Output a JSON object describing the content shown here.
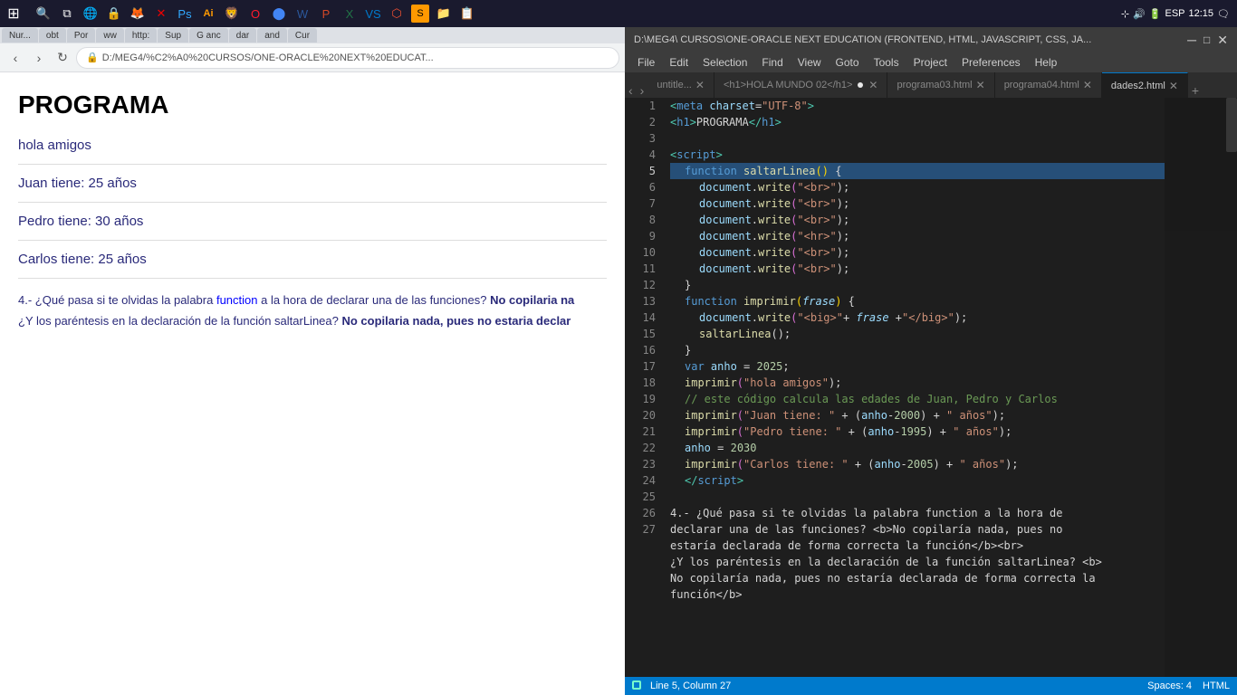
{
  "taskbar": {
    "time": "12:15",
    "lang": "ESP"
  },
  "browser": {
    "tabs": [
      {
        "label": "Nur...",
        "active": false
      },
      {
        "label": "obt",
        "active": false
      },
      {
        "label": "Por",
        "active": false
      },
      {
        "label": "ww",
        "active": false
      },
      {
        "label": "http:",
        "active": false
      },
      {
        "label": "Sup",
        "active": false
      },
      {
        "label": "G anc",
        "active": false
      },
      {
        "label": "dar",
        "active": false
      },
      {
        "label": "and",
        "active": false
      },
      {
        "label": "Cur",
        "active": false
      }
    ],
    "address": "D:/MEG4/%C2%A0%20CURSOS/ONE-ORACLE%20NEXT%20EDUCAT...",
    "content": {
      "title": "PROGRAMA",
      "line1": "hola amigos",
      "line2": "Juan tiene: 25 años",
      "line3": "Pedro tiene: 30 años",
      "line4": "Carlos tiene: 25 años",
      "question1_pre": "4.- ¿Qué pasa si te olvidas la palabra ",
      "question1_keyword": "function",
      "question1_mid": " a la hora de declarar una de las funciones? ",
      "question1_bold": "No copilaria na",
      "question2_pre": "¿Y los paréntesis en la declaración de la función saltarLinea? ",
      "question2_bold": "No copilaria nada, pues no estaria declar"
    }
  },
  "vscode": {
    "titlebar": "D:\\MEG4\\ CURSOS\\ONE-ORACLE NEXT EDUCATION (FRONTEND, HTML, JAVASCRIPT, CSS, JA...",
    "tabs": [
      {
        "label": "untitle...",
        "active": false
      },
      {
        "label": "<h1>HOLA MUNDO 02</h1>",
        "active": false,
        "dot": true
      },
      {
        "label": "programa03.html",
        "active": false
      },
      {
        "label": "programa04.html",
        "active": false
      },
      {
        "label": "dades2.html",
        "active": true
      }
    ],
    "menu": [
      "File",
      "Edit",
      "Selection",
      "Find",
      "View",
      "Goto",
      "Tools",
      "Project",
      "Preferences",
      "Help"
    ],
    "lines": [
      {
        "num": 1,
        "tokens": [
          {
            "t": "<",
            "c": "tag"
          },
          {
            "t": "meta",
            "c": "kw"
          },
          {
            "t": " charset",
            "c": "attr"
          },
          {
            "t": "=",
            "c": "op"
          },
          {
            "t": "\"UTF-8\"",
            "c": "str"
          },
          {
            "t": ">",
            "c": "tag"
          }
        ]
      },
      {
        "num": 2,
        "tokens": [
          {
            "t": "<",
            "c": "tag"
          },
          {
            "t": "h1",
            "c": "kw"
          },
          {
            "t": ">",
            "c": "tag"
          },
          {
            "t": "PROGRAMA",
            "c": "text-white"
          },
          {
            "t": "</",
            "c": "tag"
          },
          {
            "t": "h1",
            "c": "kw"
          },
          {
            "t": ">",
            "c": "tag"
          }
        ]
      },
      {
        "num": 3,
        "tokens": []
      },
      {
        "num": 4,
        "tokens": [
          {
            "t": "<",
            "c": "tag"
          },
          {
            "t": "script",
            "c": "kw"
          },
          {
            "t": ">",
            "c": "tag"
          }
        ]
      },
      {
        "num": 5,
        "tokens": [
          {
            "t": "    function ",
            "c": "kw"
          },
          {
            "t": "saltarLinea",
            "c": "fn"
          },
          {
            "t": "(",
            "c": "bracket"
          },
          {
            "t": ")",
            "c": "bracket"
          },
          {
            "t": " {",
            "c": "punct"
          }
        ],
        "highlighted": true
      },
      {
        "num": 6,
        "tokens": [
          {
            "t": "        ",
            "c": "text-white"
          },
          {
            "t": "document",
            "c": "var-col"
          },
          {
            "t": ".",
            "c": "punct"
          },
          {
            "t": "write",
            "c": "fn2"
          },
          {
            "t": "(",
            "c": "bracket2"
          },
          {
            "t": "\"<br>\"",
            "c": "str"
          },
          {
            "t": ");",
            "c": "punct"
          }
        ]
      },
      {
        "num": 7,
        "tokens": [
          {
            "t": "        ",
            "c": "text-white"
          },
          {
            "t": "document",
            "c": "var-col"
          },
          {
            "t": ".",
            "c": "punct"
          },
          {
            "t": "write",
            "c": "fn2"
          },
          {
            "t": "(",
            "c": "bracket2"
          },
          {
            "t": "\"<br>\"",
            "c": "str"
          },
          {
            "t": ");",
            "c": "punct"
          }
        ]
      },
      {
        "num": 8,
        "tokens": [
          {
            "t": "        ",
            "c": "text-white"
          },
          {
            "t": "document",
            "c": "var-col"
          },
          {
            "t": ".",
            "c": "punct"
          },
          {
            "t": "write",
            "c": "fn2"
          },
          {
            "t": "(",
            "c": "bracket2"
          },
          {
            "t": "\"<br>\"",
            "c": "str"
          },
          {
            "t": ");",
            "c": "punct"
          }
        ]
      },
      {
        "num": 9,
        "tokens": [
          {
            "t": "        ",
            "c": "text-white"
          },
          {
            "t": "document",
            "c": "var-col"
          },
          {
            "t": ".",
            "c": "punct"
          },
          {
            "t": "write",
            "c": "fn2"
          },
          {
            "t": "(",
            "c": "bracket2"
          },
          {
            "t": "\"<hr>\"",
            "c": "str"
          },
          {
            "t": ");",
            "c": "punct"
          }
        ]
      },
      {
        "num": 10,
        "tokens": [
          {
            "t": "        ",
            "c": "text-white"
          },
          {
            "t": "document",
            "c": "var-col"
          },
          {
            "t": ".",
            "c": "punct"
          },
          {
            "t": "write",
            "c": "fn2"
          },
          {
            "t": "(",
            "c": "bracket2"
          },
          {
            "t": "\"<br>\"",
            "c": "str"
          },
          {
            "t": ");",
            "c": "punct"
          }
        ]
      },
      {
        "num": 11,
        "tokens": [
          {
            "t": "        ",
            "c": "text-white"
          },
          {
            "t": "document",
            "c": "var-col"
          },
          {
            "t": ".",
            "c": "punct"
          },
          {
            "t": "write",
            "c": "fn2"
          },
          {
            "t": "(",
            "c": "bracket2"
          },
          {
            "t": "\"<br>\"",
            "c": "str"
          },
          {
            "t": ");",
            "c": "punct"
          }
        ]
      },
      {
        "num": 12,
        "tokens": [
          {
            "t": "    }",
            "c": "punct"
          }
        ]
      },
      {
        "num": 13,
        "tokens": [
          {
            "t": "    function ",
            "c": "kw"
          },
          {
            "t": "imprimir",
            "c": "fn"
          },
          {
            "t": "(",
            "c": "bracket"
          },
          {
            "t": "frase",
            "c": "param"
          },
          {
            "t": ")",
            "c": "bracket"
          },
          {
            "t": " {",
            "c": "punct"
          }
        ]
      },
      {
        "num": 14,
        "tokens": [
          {
            "t": "        ",
            "c": "text-white"
          },
          {
            "t": "document",
            "c": "var-col"
          },
          {
            "t": ".",
            "c": "punct"
          },
          {
            "t": "write",
            "c": "fn2"
          },
          {
            "t": "(",
            "c": "bracket2"
          },
          {
            "t": "\"<big>\"",
            "c": "str"
          },
          {
            "t": "+",
            "c": "op"
          },
          {
            "t": " frase ",
            "c": "param"
          },
          {
            "t": "+",
            "c": "op"
          },
          {
            "t": "\"</big>\"",
            "c": "str"
          },
          {
            "t": ");",
            "c": "punct"
          }
        ]
      },
      {
        "num": 15,
        "tokens": [
          {
            "t": "        ",
            "c": "text-white"
          },
          {
            "t": "saltarLinea",
            "c": "fn2"
          },
          {
            "t": "();",
            "c": "punct"
          }
        ]
      },
      {
        "num": 16,
        "tokens": [
          {
            "t": "    }",
            "c": "punct"
          }
        ]
      },
      {
        "num": 17,
        "tokens": [
          {
            "t": "    ",
            "c": "text-white"
          },
          {
            "t": "var",
            "c": "kw"
          },
          {
            "t": " anho ",
            "c": "var-col"
          },
          {
            "t": "=",
            "c": "op"
          },
          {
            "t": " 2025",
            "c": "num"
          },
          {
            "t": ";",
            "c": "punct"
          }
        ]
      },
      {
        "num": 18,
        "tokens": [
          {
            "t": "    ",
            "c": "text-white"
          },
          {
            "t": "imprimir",
            "c": "fn2"
          },
          {
            "t": "(",
            "c": "bracket2"
          },
          {
            "t": "\"hola amigos\"",
            "c": "str"
          },
          {
            "t": ");",
            "c": "punct"
          }
        ]
      },
      {
        "num": 19,
        "tokens": [
          {
            "t": "    ",
            "c": "cmt"
          },
          {
            "t": "// este código calcula las edades de Juan, Pedro y Carlos",
            "c": "cmt"
          }
        ]
      },
      {
        "num": 20,
        "tokens": [
          {
            "t": "    ",
            "c": "text-white"
          },
          {
            "t": "imprimir",
            "c": "fn2"
          },
          {
            "t": "(",
            "c": "bracket2"
          },
          {
            "t": "\"Juan tiene: \"",
            "c": "str"
          },
          {
            "t": " + (",
            "c": "op"
          },
          {
            "t": "anho",
            "c": "var-col"
          },
          {
            "t": "-",
            "c": "op"
          },
          {
            "t": "2000",
            "c": "num"
          },
          {
            "t": ") + ",
            "c": "op"
          },
          {
            "t": "\" años\"",
            "c": "str"
          },
          {
            "t": ");",
            "c": "punct"
          }
        ]
      },
      {
        "num": 21,
        "tokens": [
          {
            "t": "    ",
            "c": "text-white"
          },
          {
            "t": "imprimir",
            "c": "fn2"
          },
          {
            "t": "(",
            "c": "bracket2"
          },
          {
            "t": "\"Pedro tiene: \"",
            "c": "str"
          },
          {
            "t": " + (",
            "c": "op"
          },
          {
            "t": "anho",
            "c": "var-col"
          },
          {
            "t": "-",
            "c": "op"
          },
          {
            "t": "1995",
            "c": "num"
          },
          {
            "t": ") + ",
            "c": "op"
          },
          {
            "t": "\" años\"",
            "c": "str"
          },
          {
            "t": ");",
            "c": "punct"
          }
        ]
      },
      {
        "num": 22,
        "tokens": [
          {
            "t": "    ",
            "c": "text-white"
          },
          {
            "t": "anho",
            "c": "var-col"
          },
          {
            "t": " = ",
            "c": "op"
          },
          {
            "t": "2030",
            "c": "num"
          }
        ]
      },
      {
        "num": 23,
        "tokens": [
          {
            "t": "    ",
            "c": "text-white"
          },
          {
            "t": "imprimir",
            "c": "fn2"
          },
          {
            "t": "(",
            "c": "bracket2"
          },
          {
            "t": "\"Carlos tiene: \"",
            "c": "str"
          },
          {
            "t": " + (",
            "c": "op"
          },
          {
            "t": "anho",
            "c": "var-col"
          },
          {
            "t": "-",
            "c": "op"
          },
          {
            "t": "2005",
            "c": "num"
          },
          {
            "t": ") + ",
            "c": "op"
          },
          {
            "t": "\" años\"",
            "c": "str"
          },
          {
            "t": ");",
            "c": "punct"
          }
        ]
      },
      {
        "num": 24,
        "tokens": [
          {
            "t": "    </",
            "c": "tag"
          },
          {
            "t": "script",
            "c": "kw"
          },
          {
            "t": ">",
            "c": "tag"
          }
        ]
      },
      {
        "num": 25,
        "tokens": []
      },
      {
        "num": 26,
        "tokens": [
          {
            "t": "4.- ¿Qué pasa si te olvidas la palabra function a la hora de",
            "c": "text-white"
          }
        ]
      },
      {
        "num": "",
        "tokens": [
          {
            "t": "declarar una de las funciones? <b>No copilaría nada, pues no",
            "c": "text-white"
          }
        ]
      },
      {
        "num": "",
        "tokens": [
          {
            "t": "estaría declarada de forma correcta la función</b><br>",
            "c": "text-white"
          }
        ]
      },
      {
        "num": 27,
        "tokens": [
          {
            "t": "¿Y los paréntesis en la declaración de la función saltarLinea? <b>",
            "c": "text-white"
          }
        ]
      },
      {
        "num": "",
        "tokens": [
          {
            "t": "No copilaría nada, pues no estaría declarada de forma correcta la",
            "c": "text-white"
          }
        ]
      },
      {
        "num": "",
        "tokens": [
          {
            "t": "función</b>",
            "c": "text-white"
          }
        ]
      }
    ],
    "statusbar": {
      "left": "Line 5, Column 27",
      "spaces": "Spaces: 4",
      "lang": "HTML"
    }
  }
}
